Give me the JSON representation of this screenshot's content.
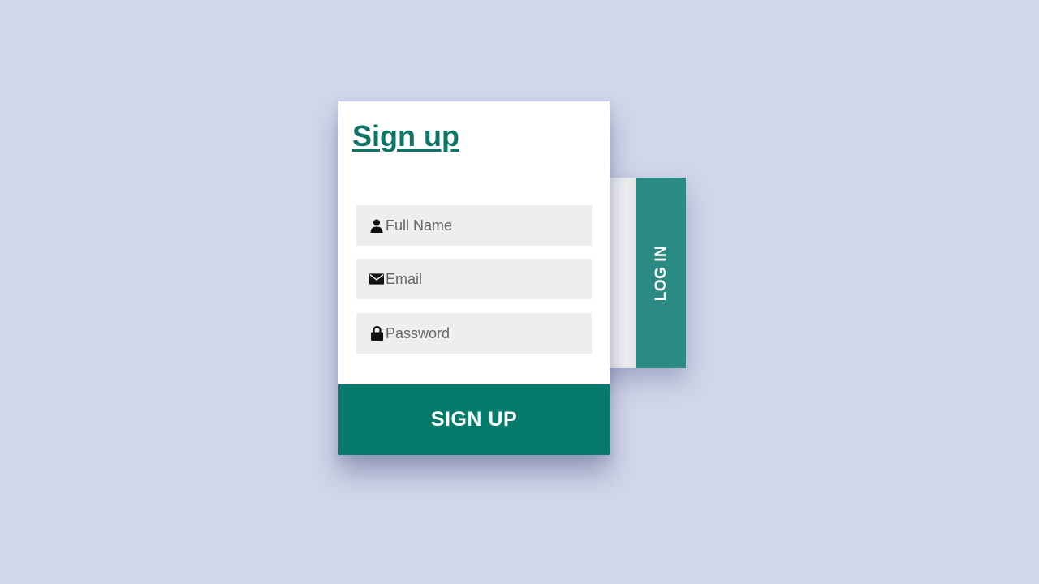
{
  "signup": {
    "title": "Sign up",
    "fields": {
      "full_name": {
        "placeholder": "Full Name",
        "value": ""
      },
      "email": {
        "placeholder": "Email",
        "value": ""
      },
      "password": {
        "placeholder": "Password",
        "value": ""
      }
    },
    "submit_label": "SIGN UP"
  },
  "login": {
    "tab_label": "LOG IN"
  },
  "icons": {
    "full_name": "user-icon",
    "email": "envelope-icon",
    "password": "lock-icon"
  },
  "colors": {
    "background": "#d2d6ea",
    "accent": "#067b6b",
    "title": "#0e7468",
    "login_tab": "#2b8a83",
    "field_bg": "#eeeeee"
  }
}
